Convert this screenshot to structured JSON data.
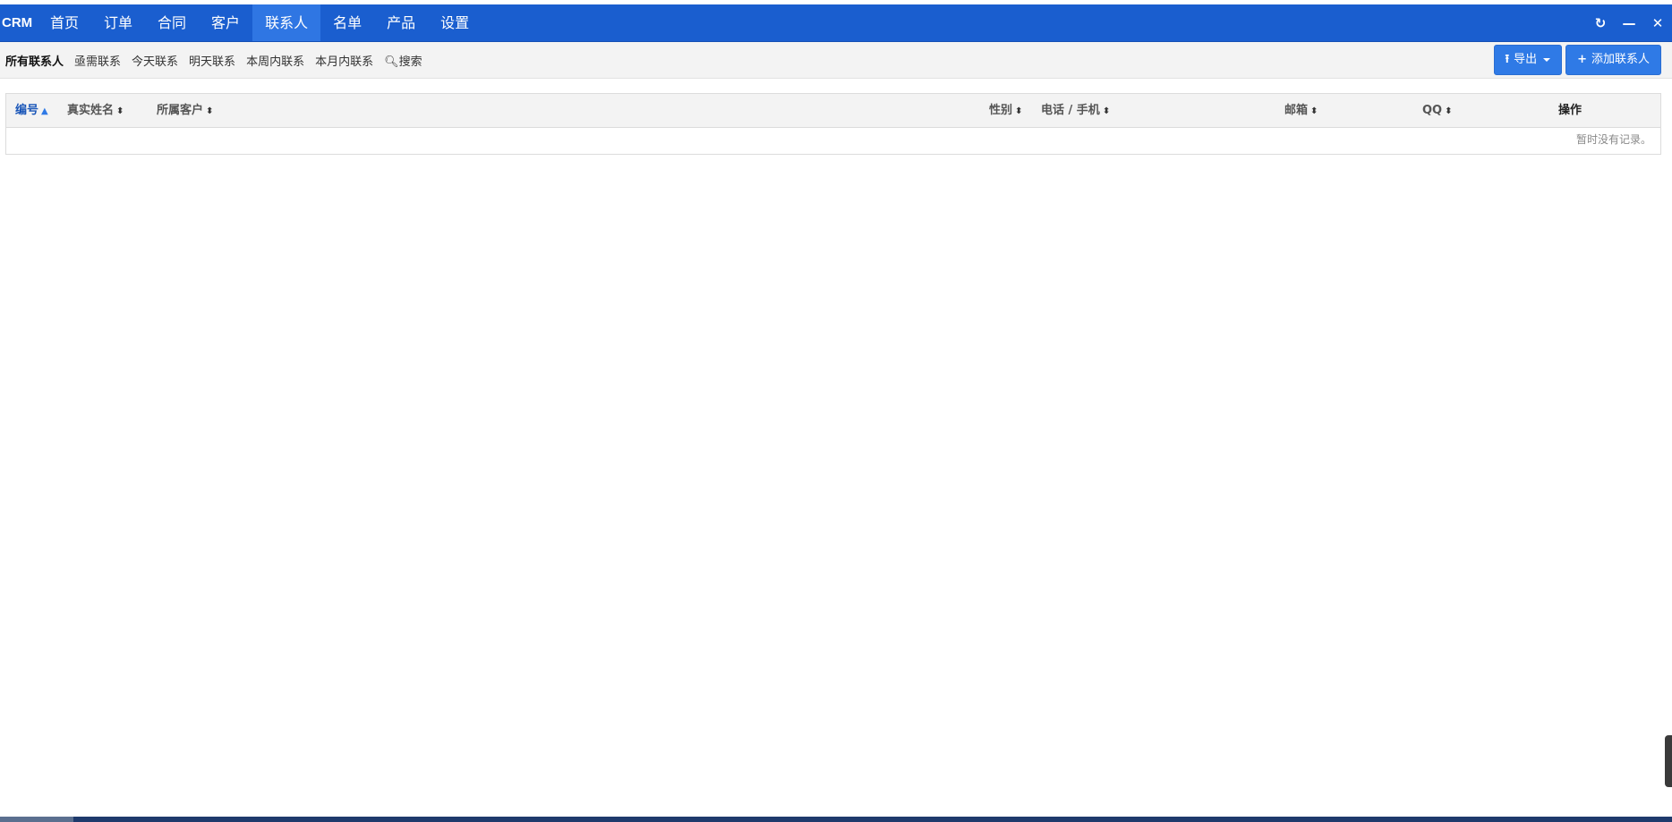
{
  "app": {
    "brand": "CRM"
  },
  "nav": {
    "items": [
      {
        "label": "首页"
      },
      {
        "label": "订单"
      },
      {
        "label": "合同"
      },
      {
        "label": "客户"
      },
      {
        "label": "联系人"
      },
      {
        "label": "名单"
      },
      {
        "label": "产品"
      },
      {
        "label": "设置"
      }
    ],
    "active_index": 4
  },
  "window_controls": [
    "refresh-icon",
    "minimize-icon",
    "close-icon"
  ],
  "filters": {
    "items": [
      {
        "label": "所有联系人"
      },
      {
        "label": "亟需联系"
      },
      {
        "label": "今天联系"
      },
      {
        "label": "明天联系"
      },
      {
        "label": "本周内联系"
      },
      {
        "label": "本月内联系"
      }
    ],
    "active_index": 0,
    "search_label": "搜索"
  },
  "actions": {
    "export_label": "导出",
    "add_label": "添加联系人"
  },
  "table": {
    "columns": [
      {
        "label": "编号",
        "sort": "asc"
      },
      {
        "label": "真实姓名",
        "sort": "both"
      },
      {
        "label": "所属客户",
        "sort": "both"
      },
      {
        "label": "性别",
        "sort": "both"
      },
      {
        "label": "电话 / 手机",
        "sort": "both"
      },
      {
        "label": "邮箱",
        "sort": "both"
      },
      {
        "label": "QQ",
        "sort": "both"
      },
      {
        "label": "操作",
        "sort": "none"
      }
    ],
    "empty_message": "暂时没有记录。"
  },
  "colors": {
    "topbar": "#1a5ecf",
    "nav_active": "#2f76e3",
    "button": "#2f7ae6",
    "sorted_header": "#1a56b8"
  }
}
